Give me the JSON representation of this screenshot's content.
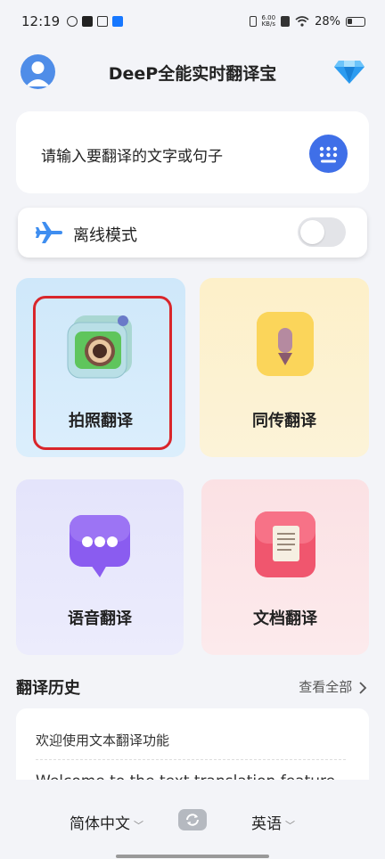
{
  "status_bar": {
    "time": "12:19",
    "net_speed_value": "6.00",
    "net_speed_unit": "KB/s",
    "battery": "28%"
  },
  "header": {
    "title": "DeeP全能实时翻译宝",
    "avatar_icon": "user-avatar-icon",
    "vip_icon": "diamond-icon"
  },
  "input_card": {
    "prompt": "请输入要翻译的文字或句子",
    "keyboard_icon": "keyboard-icon"
  },
  "offline_mode": {
    "label": "离线模式",
    "enabled": false
  },
  "features": [
    {
      "label": "拍照翻译",
      "icon": "camera-icon",
      "color": "#d4ecfb"
    },
    {
      "label": "同传翻译",
      "icon": "microphone-icon",
      "color": "#fdf2cf"
    },
    {
      "label": "语音翻译",
      "icon": "chat-bubble-icon",
      "color": "#e7e7fb"
    },
    {
      "label": "文档翻译",
      "icon": "document-icon",
      "color": "#fbe4e7"
    }
  ],
  "history": {
    "title": "翻译历史",
    "view_all": "查看全部",
    "items": [
      {
        "source": "欢迎使用文本翻译功能",
        "target": "Welcome to the text translation feature"
      }
    ]
  },
  "language_bar": {
    "source": "简体中文",
    "target": "英语"
  },
  "colors": {
    "accent": "#3f6fe8",
    "highlight_border": "#d9262b"
  }
}
